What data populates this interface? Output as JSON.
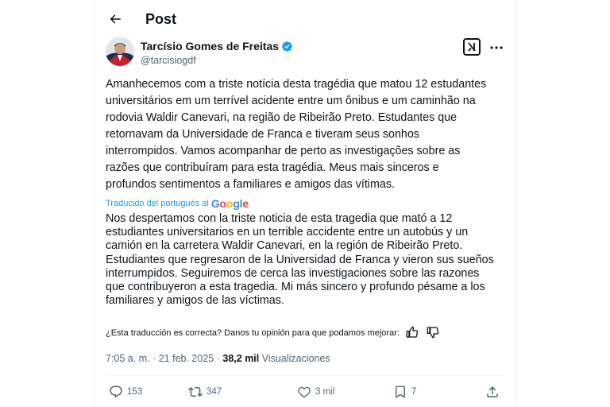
{
  "header": {
    "title": "Post"
  },
  "author": {
    "name": "Tarcísio Gomes de Freitas",
    "handle": "@tarcisiogdf"
  },
  "tweet": {
    "text": "Amanhecemos com a triste notícia desta tragédia que matou 12 estudantes\nuniversitários em um terrível acidente entre um ônibus e um caminhão na\nrodovia Waldir Canevari, na região de Ribeirão Preto. Estudantes que\nretornavam da Universidade de Franca e tiveram seus sonhos\ninterrompidos. Vamos acompanhar de perto as investigações sobre as\nrazões que contribuíram para esta tragédia. Meus mais sinceros e\nprofundos sentimentos a familiares e amigos das vítimas."
  },
  "translation": {
    "label": "Traducido del portugués al",
    "provider": "Google",
    "text": "Nos despertamos con la triste noticia de esta tragedia que mató a 12\nestudiantes universitarios en un terrible accidente entre un autobús y un\ncamión en la carretera Waldir Canevari, en la región de Ribeirão Preto.\nEstudiantes que regresaron de la Universidad de Franca y vieron sus sueños\ninterrumpidos. Seguiremos de cerca las investigaciones sobre las razones\nque contribuyeron a esta tragedia. Mi más sincero y profundo pésame a los\nfamiliares y amigos de las víctimas.",
    "feedback_question": "¿Esta traducción es correcta? Danos tu opinión para que podamos mejorar:"
  },
  "meta": {
    "time": "7:05 a. m.",
    "separator": "·",
    "date": "21 feb. 2025",
    "views_count": "38,2 mil",
    "views_label": "Visualizaciones"
  },
  "actions": {
    "replies": "153",
    "reposts": "347",
    "likes": "3 mil",
    "bookmarks": "7"
  },
  "colors": {
    "accent": "#1d9bf0",
    "text": "#0f1419",
    "muted": "#536471"
  },
  "icons": [
    "back-arrow-icon",
    "verified-badge-icon",
    "grok-icon",
    "more-icon",
    "thumbs-up-icon",
    "thumbs-down-icon",
    "reply-icon",
    "repost-icon",
    "like-icon",
    "bookmark-icon",
    "share-icon"
  ]
}
